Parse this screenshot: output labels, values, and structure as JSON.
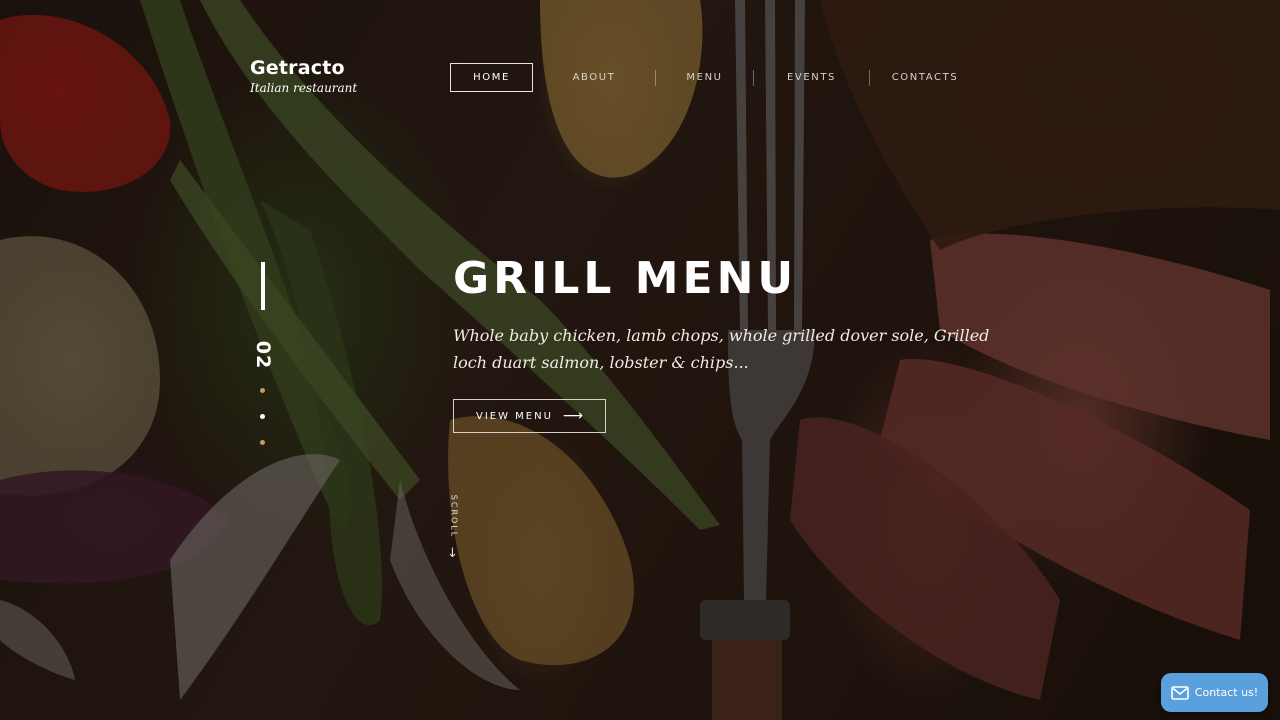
{
  "brand": {
    "name": "Getracto",
    "tagline": "Italian restaurant"
  },
  "nav": {
    "items": [
      {
        "label": "HOME",
        "active": true
      },
      {
        "label": "ABOUT",
        "active": false
      },
      {
        "label": "MENU",
        "active": false
      },
      {
        "label": "EVENTS",
        "active": false
      },
      {
        "label": "CONTACTS",
        "active": false
      }
    ]
  },
  "slider": {
    "current": "02",
    "total_dots": 3,
    "active_dot": 2
  },
  "hero": {
    "title": "GRILL MENU",
    "description": "Whole baby chicken, lamb chops, whole grilled dover sole, Grilled loch duart salmon, lobster & chips...",
    "cta_label": "VIEW MENU",
    "cta_icon": "arrow-right-icon"
  },
  "scroll": {
    "label": "SCROLL",
    "icon": "arrow-down-icon"
  },
  "contact": {
    "label": "Contact us!",
    "icon": "envelope-icon",
    "color": "#5aa0dc"
  }
}
